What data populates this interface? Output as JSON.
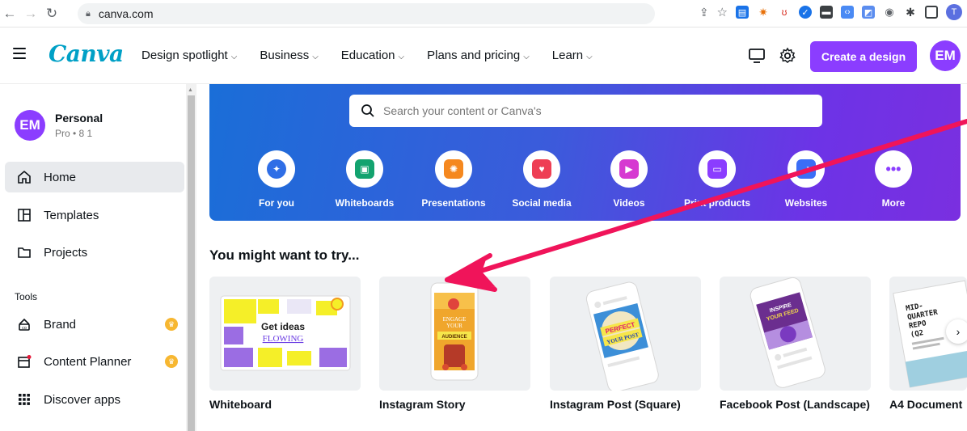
{
  "browser": {
    "url": "canva.com",
    "profile_initial": "T"
  },
  "header": {
    "logo": "Canva",
    "nav": [
      {
        "label": "Design spotlight"
      },
      {
        "label": "Business"
      },
      {
        "label": "Education"
      },
      {
        "label": "Plans and pricing"
      },
      {
        "label": "Learn"
      }
    ],
    "create_label": "Create a design",
    "avatar_initials": "EM"
  },
  "sidebar": {
    "account": {
      "initials": "EM",
      "name": "Personal",
      "plan": "Pro • 8 1"
    },
    "items": [
      {
        "label": "Home",
        "icon": "home-icon"
      },
      {
        "label": "Templates",
        "icon": "templates-icon"
      },
      {
        "label": "Projects",
        "icon": "folder-icon"
      }
    ],
    "tools_label": "Tools",
    "tools": [
      {
        "label": "Brand",
        "icon": "brand-icon"
      },
      {
        "label": "Content Planner",
        "icon": "calendar-icon"
      },
      {
        "label": "Discover apps",
        "icon": "apps-grid-icon"
      }
    ]
  },
  "banner": {
    "search_placeholder": "Search your content or Canva's",
    "categories": [
      {
        "label": "For you",
        "color": "#2f6ee6"
      },
      {
        "label": "Whiteboards",
        "color": "#13a36f"
      },
      {
        "label": "Presentations",
        "color": "#f5881f"
      },
      {
        "label": "Social media",
        "color": "#ee3e54"
      },
      {
        "label": "Videos",
        "color": "#d63ad1"
      },
      {
        "label": "Print products",
        "color": "#8b3dff"
      },
      {
        "label": "Websites",
        "color": "#3b6ef6"
      },
      {
        "label": "More",
        "color": "#8b3dff"
      }
    ]
  },
  "suggestions": {
    "title": "You might want to try...",
    "cards": [
      {
        "label": "Whiteboard",
        "art_text": "Get ideas FLOWING"
      },
      {
        "label": "Instagram Story",
        "art_text": "ENGAGE YOUR AUDIENCE"
      },
      {
        "label": "Instagram Post (Square)",
        "art_text": "PERFECT YOUR POST"
      },
      {
        "label": "Facebook Post (Landscape)",
        "art_text": "INSPIRE YOUR FEED"
      },
      {
        "label": "A4 Document",
        "art_text": "MID-QUARTER REPO (Q2"
      }
    ]
  },
  "colors": {
    "accent": "#8b3dff",
    "annotation_arrow": "#f0145a",
    "logo": "#00a0c6"
  }
}
